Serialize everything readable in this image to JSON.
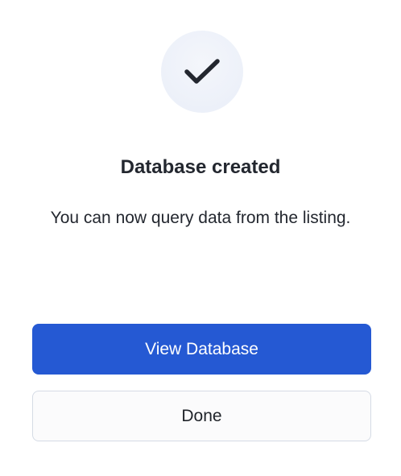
{
  "dialog": {
    "icon": "check-icon",
    "title": "Database created",
    "message": "You can now query data from the listing.",
    "primary_button": "View Database",
    "secondary_button": "Done"
  },
  "colors": {
    "primary": "#2559d3",
    "icon_bg": "#e9eef8",
    "text": "#23272f",
    "secondary_border": "#d5dbe5"
  }
}
